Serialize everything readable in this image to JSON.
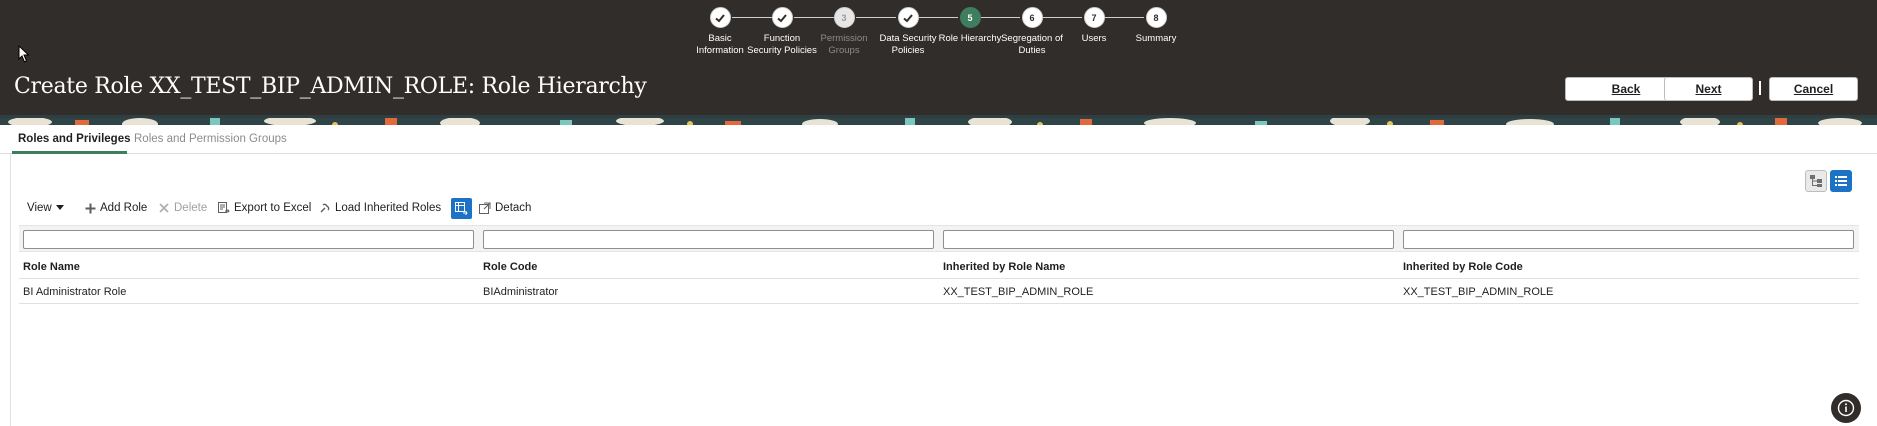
{
  "train": {
    "steps": [
      {
        "label": "Basic\nInformation",
        "state": "done",
        "number": "1"
      },
      {
        "label": "Function\nSecurity Policies",
        "state": "done",
        "number": "2"
      },
      {
        "label": "Permission\nGroups",
        "state": "disabled",
        "number": "3"
      },
      {
        "label": "Data Security\nPolicies",
        "state": "done",
        "number": "4"
      },
      {
        "label": "Role Hierarchy",
        "state": "current",
        "number": "5"
      },
      {
        "label": "Segregation of\nDuties",
        "state": "todo",
        "number": "6"
      },
      {
        "label": "Users",
        "state": "todo",
        "number": "7"
      },
      {
        "label": "Summary",
        "state": "todo",
        "number": "8"
      }
    ]
  },
  "header": {
    "title": "Create Role XX_TEST_BIP_ADMIN_ROLE: Role Hierarchy",
    "back_label": "Back",
    "next_label": "Next",
    "cancel_label": "Cancel"
  },
  "tabs": [
    {
      "label": "Roles and Privileges",
      "active": true
    },
    {
      "label": "Roles and Permission Groups",
      "active": false
    }
  ],
  "toolbar": {
    "view_label": "View",
    "add_role_label": "Add Role",
    "delete_label": "Delete",
    "export_label": "Export to Excel",
    "load_inherited_label": "Load Inherited Roles",
    "detach_label": "Detach"
  },
  "table": {
    "filters": [
      "",
      "",
      "",
      ""
    ],
    "columns": [
      "Role Name",
      "Role Code",
      "Inherited by Role Name",
      "Inherited by Role Code"
    ],
    "rows": [
      [
        "BI Administrator Role",
        "BIAdministrator",
        "XX_TEST_BIP_ADMIN_ROLE",
        "XX_TEST_BIP_ADMIN_ROLE"
      ]
    ]
  },
  "colors": {
    "header_bg": "#312d2a",
    "accent_green": "#3e7e5e",
    "accent_blue": "#1c73c6"
  }
}
